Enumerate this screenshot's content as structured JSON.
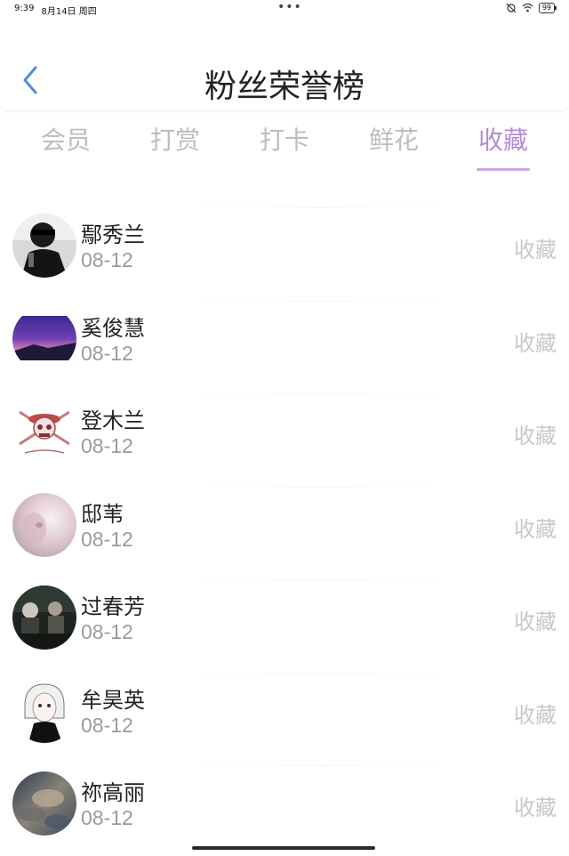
{
  "status_bar": {
    "time": "9:39",
    "date": "8月14日 周四",
    "dots": "•••",
    "battery": "99"
  },
  "header": {
    "title": "粉丝荣誉榜"
  },
  "tabs": [
    {
      "label": "会员",
      "active": false
    },
    {
      "label": "打赏",
      "active": false
    },
    {
      "label": "打卡",
      "active": false
    },
    {
      "label": "鲜花",
      "active": false
    },
    {
      "label": "收藏",
      "active": true
    }
  ],
  "colors": {
    "accent": "#b58bd6",
    "back_icon": "#4a90d9",
    "inactive_tab": "#bdbdbd",
    "muted_text": "#9b9b9b",
    "action_text": "#c8c8c8"
  },
  "list": {
    "items": [
      {
        "name": "鄢秀兰",
        "date": "08-12",
        "action": "收藏",
        "avatar": "avatar-photo-man-sunglasses"
      },
      {
        "name": "奚俊慧",
        "date": "08-12",
        "action": "收藏",
        "avatar": "avatar-photo-purple-sky"
      },
      {
        "name": "登木兰",
        "date": "08-12",
        "action": "收藏",
        "avatar": "avatar-photo-skull-logo"
      },
      {
        "name": "邸苇",
        "date": "08-12",
        "action": "收藏",
        "avatar": "avatar-photo-blurry-face"
      },
      {
        "name": "过春芳",
        "date": "08-12",
        "action": "收藏",
        "avatar": "avatar-photo-dark-people"
      },
      {
        "name": "牟昊英",
        "date": "08-12",
        "action": "收藏",
        "avatar": "avatar-photo-anime-girl"
      },
      {
        "name": "祢高丽",
        "date": "08-12",
        "action": "收藏",
        "avatar": "avatar-photo-cloudy-sky"
      }
    ]
  }
}
